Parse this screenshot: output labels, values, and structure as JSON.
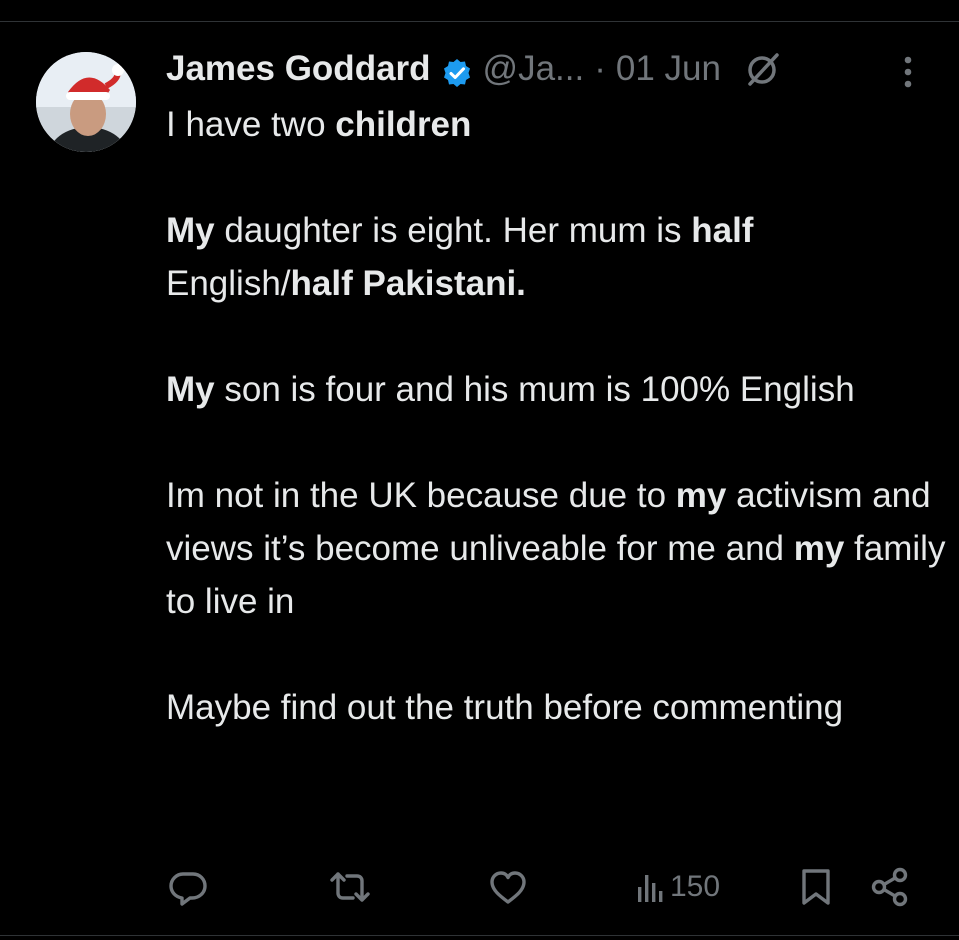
{
  "tweet": {
    "author": {
      "name": "James Goddard",
      "handle": "@Ja...",
      "verified": true
    },
    "separator": "·",
    "date": "01 Jun",
    "paragraphs": [
      [
        {
          "text": "I have two ",
          "bold": false
        },
        {
          "text": "children",
          "bold": true
        }
      ],
      [
        {
          "text": "My",
          "bold": true
        },
        {
          "text": " daughter is eight. Her mum is ",
          "bold": false
        },
        {
          "text": "half",
          "bold": true
        },
        {
          "text": " English/",
          "bold": false
        },
        {
          "text": "half Pakistani.",
          "bold": true
        }
      ],
      [
        {
          "text": "My",
          "bold": true
        },
        {
          "text": " son is four and his mum is 100% English",
          "bold": false
        }
      ],
      [
        {
          "text": "Im not in the UK because due to ",
          "bold": false
        },
        {
          "text": "my",
          "bold": true
        },
        {
          "text": " activism and views it’s become unliveable for me and ",
          "bold": false
        },
        {
          "text": "my",
          "bold": true
        },
        {
          "text": " family to live in",
          "bold": false
        }
      ],
      [
        {
          "text": "Maybe find out the truth before commenting",
          "bold": false
        }
      ]
    ],
    "actions": {
      "reply_icon": "reply-icon",
      "retweet_icon": "retweet-icon",
      "like_icon": "like-icon",
      "views_icon": "views-icon",
      "views_count": "150",
      "bookmark_icon": "bookmark-icon",
      "share_icon": "share-icon"
    }
  },
  "colors": {
    "background": "#000000",
    "text_primary": "#e7e9ea",
    "text_secondary": "#71767b",
    "verified_blue": "#1d9bf0",
    "border": "#2f3336"
  }
}
